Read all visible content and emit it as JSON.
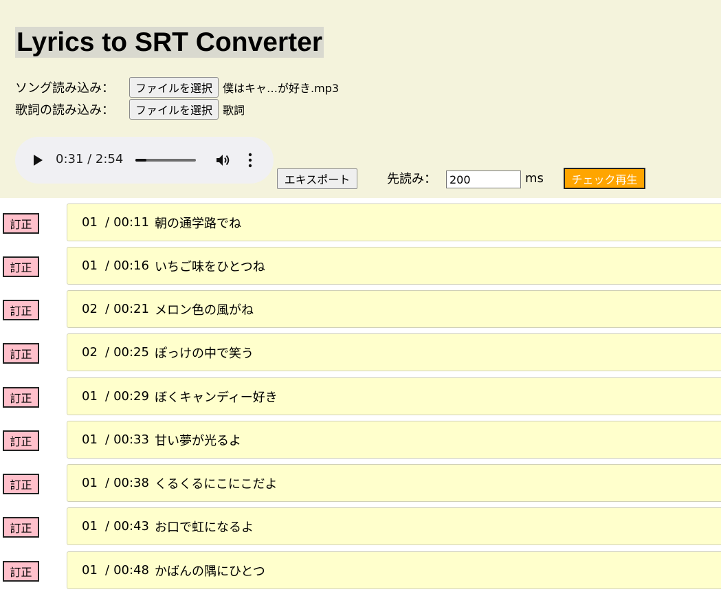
{
  "app": {
    "title": "Lyrics to SRT Converter"
  },
  "song_loader": {
    "label": "ソング読み込み：",
    "button": "ファイルを選択",
    "file_name": "僕はキャ…が好き.mp3"
  },
  "lyrics_loader": {
    "label": "歌詞の読み込み：",
    "button": "ファイルを選択",
    "file_name": "歌詞"
  },
  "player": {
    "time_display": "0:31 / 2:54",
    "progress": 0.178
  },
  "toolbar": {
    "export_label": "エキスポート",
    "preread_label": "先読み：",
    "preread_value": "200",
    "preread_unit": "ms",
    "check_play_label": "チェック再生"
  },
  "lyrics": [
    {
      "fix": "訂正",
      "count": "01",
      "slash": "/",
      "time": "00:11",
      "text": "朝の通学路でね"
    },
    {
      "fix": "訂正",
      "count": "01",
      "slash": "/",
      "time": "00:16",
      "text": "いちご味をひとつね"
    },
    {
      "fix": "訂正",
      "count": "02",
      "slash": "/",
      "time": "00:21",
      "text": "メロン色の風がね"
    },
    {
      "fix": "訂正",
      "count": "02",
      "slash": "/",
      "time": "00:25",
      "text": "ぽっけの中で笑う"
    },
    {
      "fix": "訂正",
      "count": "01",
      "slash": "/",
      "time": "00:29",
      "text": "ぼくキャンディー好き"
    },
    {
      "fix": "訂正",
      "count": "01",
      "slash": "/",
      "time": "00:33",
      "text": "甘い夢が光るよ"
    },
    {
      "fix": "訂正",
      "count": "01",
      "slash": "/",
      "time": "00:38",
      "text": "くるくるにこにこだよ"
    },
    {
      "fix": "訂正",
      "count": "01",
      "slash": "/",
      "time": "00:43",
      "text": "お口で虹になるよ"
    },
    {
      "fix": "訂正",
      "count": "01",
      "slash": "/",
      "time": "00:48",
      "text": "かばんの隅にひとつ"
    }
  ],
  "colors": {
    "header_bg": "#f4f3dc",
    "lyric_bg": "#ffffcc",
    "fix_button_bg": "#ffc0cb",
    "check_button_bg": "#ffa500"
  },
  "icons": [
    "play-icon",
    "volume-icon",
    "more-options-icon"
  ]
}
